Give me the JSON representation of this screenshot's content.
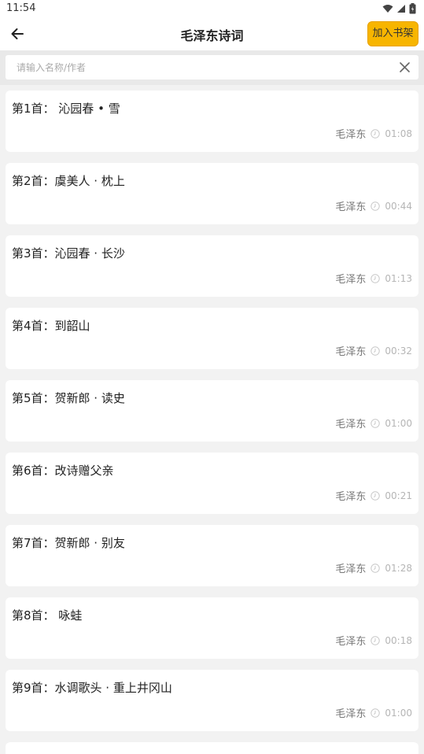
{
  "status": {
    "time": "11:54"
  },
  "header": {
    "title": "毛泽东诗词",
    "add_button": "加入书架"
  },
  "search": {
    "placeholder": "请输入名称/作者",
    "value": ""
  },
  "items": [
    {
      "title": "第1首：  沁园春 • 雪",
      "author": "毛泽东",
      "duration": "01:08"
    },
    {
      "title": "第2首：虞美人 · 枕上",
      "author": "毛泽东",
      "duration": "00:44"
    },
    {
      "title": "第3首：沁园春 · 长沙",
      "author": "毛泽东",
      "duration": "01:13"
    },
    {
      "title": "第4首：到韶山",
      "author": "毛泽东",
      "duration": "00:32"
    },
    {
      "title": "第5首：贺新郎 · 读史",
      "author": "毛泽东",
      "duration": "01:00"
    },
    {
      "title": "第6首：改诗赠父亲",
      "author": "毛泽东",
      "duration": "00:21"
    },
    {
      "title": "第7首：贺新郎 · 别友",
      "author": "毛泽东",
      "duration": "01:28"
    },
    {
      "title": "第8首：  咏蛙",
      "author": "毛泽东",
      "duration": "00:18"
    },
    {
      "title": "第9首：水调歌头 · 重上井冈山",
      "author": "毛泽东",
      "duration": "01:00"
    }
  ],
  "icons": {
    "back": "arrow-left-icon",
    "clear": "close-icon",
    "clock": "clock-icon",
    "wifi": "wifi-icon",
    "signal": "signal-icon",
    "battery": "battery-icon"
  },
  "colors": {
    "accent": "#f7b500",
    "background": "#f2f2f2"
  }
}
